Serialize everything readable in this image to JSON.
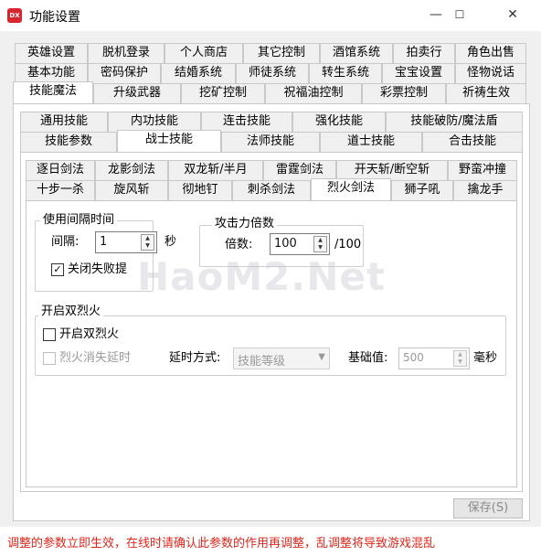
{
  "window": {
    "title": "功能设置",
    "app_icon": "DX",
    "controls": {
      "minimize": "—",
      "maximize": "☐",
      "close": "✕"
    }
  },
  "tabs_level1": {
    "row1": [
      "英雄设置",
      "脱机登录",
      "个人商店",
      "其它控制",
      "酒馆系统",
      "拍卖行",
      "角色出售"
    ],
    "row2": [
      "基本功能",
      "密码保护",
      "结婚系统",
      "师徒系统",
      "转生系统",
      "宝宝设置",
      "怪物说话"
    ],
    "row3": [
      "技能魔法",
      "升级武器",
      "挖矿控制",
      "祝福油控制",
      "彩票控制",
      "祈祷生效"
    ]
  },
  "tabs_level2": {
    "row1": [
      "通用技能",
      "内功技能",
      "连击技能",
      "强化技能",
      "技能破防/魔法盾"
    ],
    "row2": [
      "技能参数",
      "战士技能",
      "法师技能",
      "道士技能",
      "合击技能"
    ]
  },
  "tabs_level3": {
    "row1": [
      "逐日剑法",
      "龙影剑法",
      "双龙斩/半月",
      "雷霆剑法",
      "开天斩/断空斩",
      "野蛮冲撞"
    ],
    "row2": [
      "十步一杀",
      "旋风斩",
      "彻地钉",
      "刺杀剑法",
      "烈火剑法",
      "狮子吼",
      "擒龙手"
    ]
  },
  "interval_group": {
    "title": "使用间隔时间",
    "label": "间隔:",
    "value": "1",
    "unit": "秒",
    "checkbox_label": "关闭失败提",
    "checkbox_checked": true
  },
  "power_group": {
    "title": "攻击力倍数",
    "label": "倍数:",
    "value": "100",
    "suffix": "/100"
  },
  "double_fire_group": {
    "title": "开启双烈火",
    "enable_label": "开启双烈火",
    "enable_checked": false,
    "delay_label": "烈火消失延时",
    "delay_checked": false,
    "delay_mode_label": "延时方式:",
    "delay_mode_value": "技能等级",
    "base_label": "基础值:",
    "base_value": "500",
    "base_unit": "毫秒"
  },
  "save_button": "保存(S)",
  "status_text": "调整的参数立即生效，在线时请确认此参数的作用再调整，乱调整将导致游戏混乱",
  "watermark": "HaoM2.Net",
  "colors": {
    "status": "#e0261b",
    "icon": "#d8262e"
  }
}
